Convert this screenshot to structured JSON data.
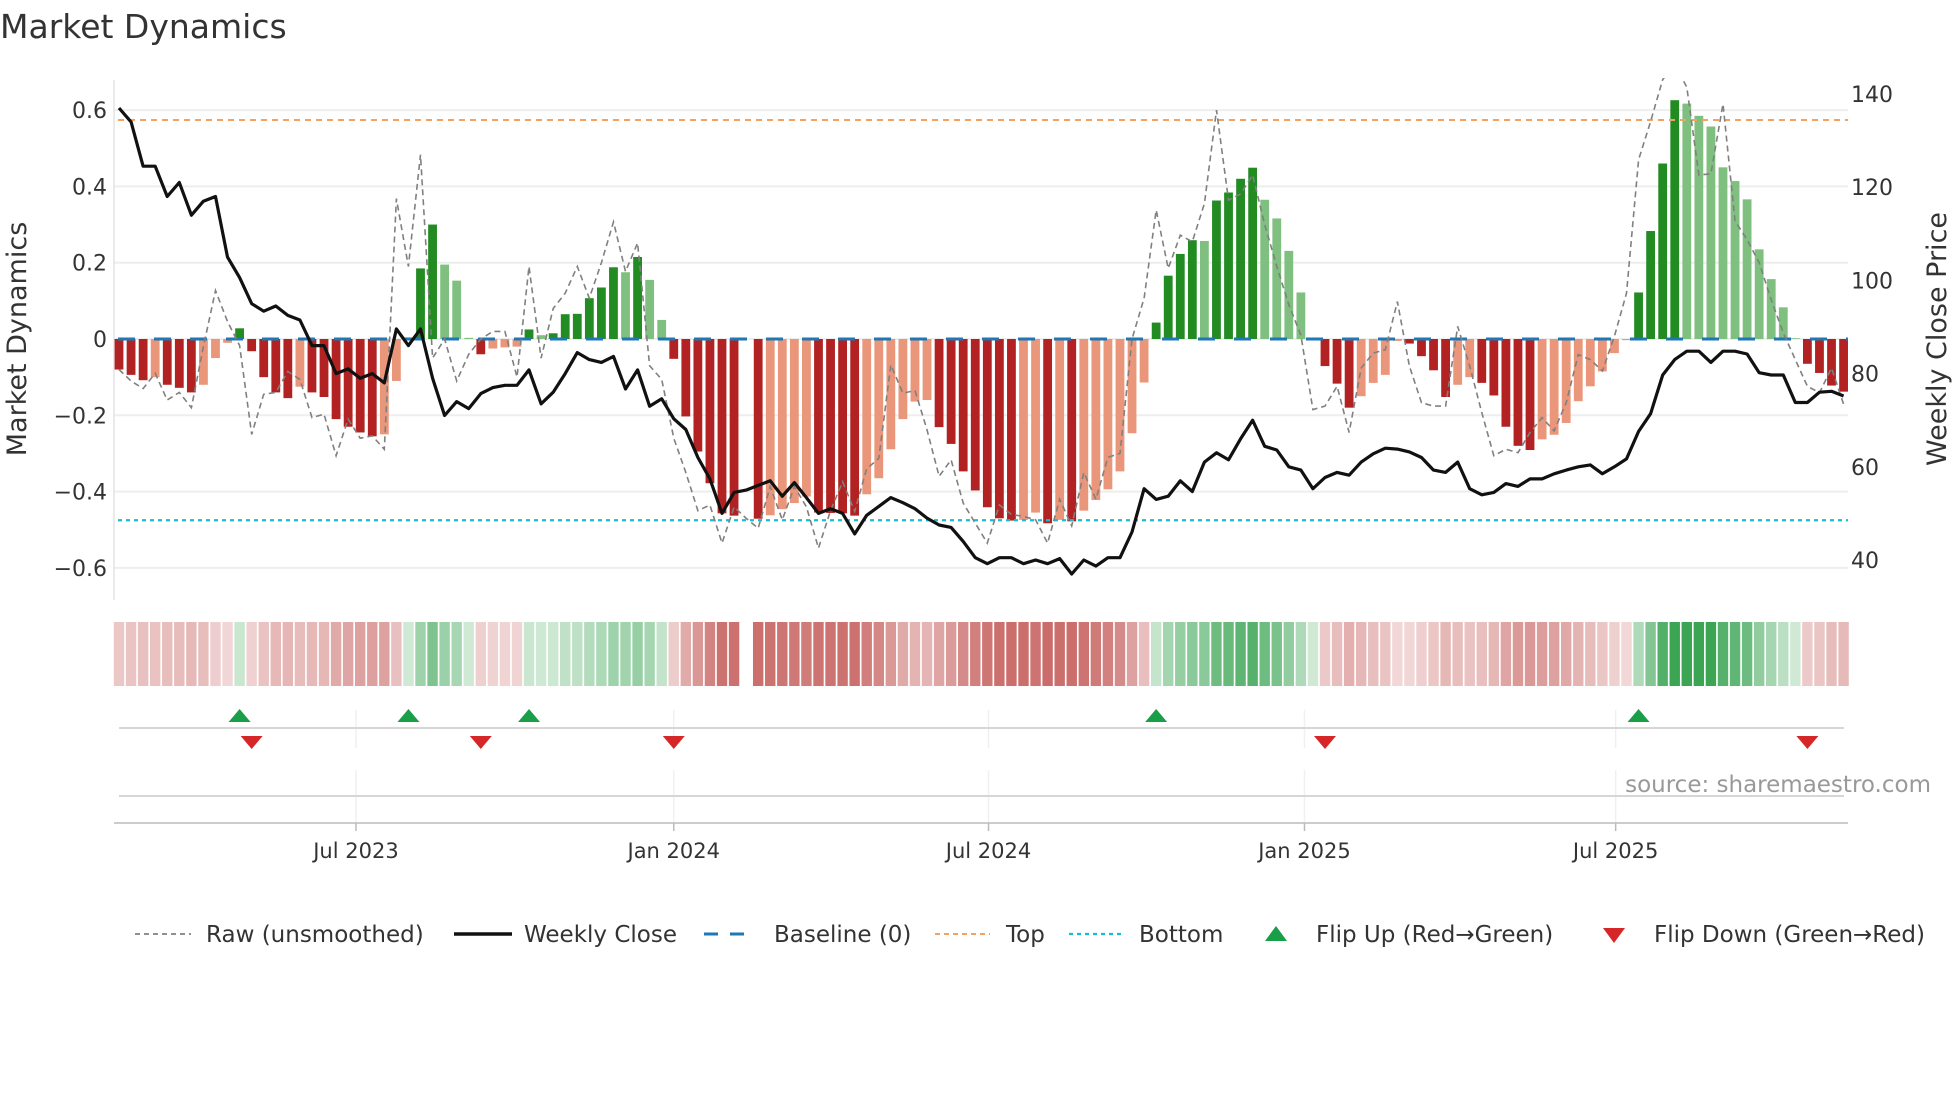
{
  "title": "Market Dynamics",
  "source": "source: sharemaestro.com",
  "colors": {
    "bar_red_dark": "#b22222",
    "bar_red_light": "#e9967a",
    "bar_green_dark": "#228b22",
    "bar_green_light": "#7fbf7f",
    "band_red": "#c0504d",
    "band_green": "#2a9d45",
    "raw": "#808080",
    "close": "#111111",
    "baseline": "#1f77b4",
    "top": "#f4a261",
    "bottom": "#17becf",
    "flip_up": "#1a9e48",
    "flip_down": "#d62728"
  },
  "legend": [
    {
      "key": "raw",
      "label": "Raw (unsmoothed)"
    },
    {
      "key": "close",
      "label": "Weekly Close"
    },
    {
      "key": "baseline",
      "label": "Baseline (0)"
    },
    {
      "key": "top",
      "label": "Top"
    },
    {
      "key": "bottom",
      "label": "Bottom"
    },
    {
      "key": "flip_up",
      "label": "Flip Up (Red→Green)"
    },
    {
      "key": "flip_down",
      "label": "Flip Down (Green→Red)"
    }
  ],
  "chart_data": {
    "type": "bar",
    "title": "Market Dynamics",
    "ylabel": "Market Dynamics",
    "ylabel_right": "Weekly Close Price",
    "ylim": [
      -0.68,
      0.68
    ],
    "ylim_right": [
      33,
      146
    ],
    "yticks": [
      0.6,
      0.4,
      0.2,
      0,
      -0.2,
      -0.4,
      -0.6
    ],
    "ytick_labels": [
      "0.6",
      "0.4",
      "0.2",
      "0",
      "−0.2",
      "−0.4",
      "−0.6"
    ],
    "yticks_right": [
      140,
      120,
      100,
      80,
      60,
      40
    ],
    "ytick_labels_right": [
      "140",
      "120",
      "100",
      "80",
      "60",
      "40"
    ],
    "xticks": [
      {
        "label": "Jul 2023",
        "week": 19.65
      },
      {
        "label": "Jan 2024",
        "week": 46.0
      },
      {
        "label": "Jul 2024",
        "week": 72.1
      },
      {
        "label": "Jan 2025",
        "week": 98.3
      },
      {
        "label": "Jul 2025",
        "week": 124.1
      }
    ],
    "top_level": 0.574,
    "bottom_level": -0.475,
    "baseline": 0,
    "grid": true,
    "legend_position": "bottom",
    "series": [
      {
        "name": "Market Dynamics (smoothed)",
        "type": "bar",
        "values": [
          -0.08,
          -0.094,
          -0.108,
          -0.1,
          -0.12,
          -0.128,
          -0.14,
          -0.12,
          -0.05,
          -0.01,
          0.028,
          -0.032,
          -0.1,
          -0.14,
          -0.155,
          -0.125,
          -0.14,
          -0.152,
          -0.21,
          -0.23,
          -0.245,
          -0.255,
          -0.25,
          -0.11,
          0.004,
          0.185,
          0.3,
          0.195,
          0.153,
          0.003,
          -0.04,
          -0.025,
          -0.022,
          -0.02,
          0.025,
          0.01,
          0.015,
          0.065,
          0.066,
          0.107,
          0.135,
          0.188,
          0.175,
          0.215,
          0.155,
          0.05,
          -0.052,
          -0.203,
          -0.295,
          -0.378,
          -0.457,
          -0.463,
          null,
          -0.471,
          -0.462,
          -0.446,
          -0.43,
          -0.413,
          -0.455,
          -0.456,
          -0.457,
          -0.463,
          -0.407,
          -0.365,
          -0.289,
          -0.21,
          -0.164,
          -0.16,
          -0.231,
          -0.275,
          -0.347,
          -0.397,
          -0.441,
          -0.47,
          -0.476,
          -0.474,
          -0.455,
          -0.483,
          -0.474,
          -0.478,
          -0.45,
          -0.422,
          -0.394,
          -0.347,
          -0.247,
          -0.114,
          0.043,
          0.166,
          0.223,
          0.259,
          0.257,
          0.363,
          0.384,
          0.42,
          0.449,
          0.365,
          0.316,
          0.231,
          0.122,
          0.003,
          -0.071,
          -0.117,
          -0.18,
          -0.15,
          -0.115,
          -0.094,
          -0.005,
          -0.012,
          -0.045,
          -0.082,
          -0.152,
          -0.12,
          -0.1,
          -0.115,
          -0.148,
          -0.23,
          -0.28,
          -0.291,
          -0.263,
          -0.251,
          -0.22,
          -0.163,
          -0.124,
          -0.085,
          -0.037,
          -0.003,
          0.122,
          0.283,
          0.46,
          0.626,
          0.617,
          0.585,
          0.557,
          0.45,
          0.414,
          0.366,
          0.235,
          0.157,
          0.083,
          0.002,
          -0.065,
          -0.089,
          -0.122,
          -0.138
        ]
      },
      {
        "name": "Raw (unsmoothed)",
        "type": "line",
        "values": [
          -0.08,
          -0.11,
          -0.13,
          -0.09,
          -0.16,
          -0.14,
          -0.18,
          -0.02,
          0.127,
          0.046,
          -0.017,
          -0.25,
          -0.145,
          -0.14,
          -0.085,
          -0.106,
          -0.206,
          -0.197,
          -0.306,
          -0.21,
          -0.26,
          -0.254,
          -0.289,
          0.368,
          0.19,
          0.483,
          -0.05,
          0.0,
          -0.11,
          -0.04,
          0.0,
          0.02,
          0.02,
          -0.1,
          0.19,
          -0.05,
          0.08,
          0.12,
          0.19,
          0.107,
          0.2,
          0.307,
          0.177,
          0.252,
          -0.07,
          -0.106,
          -0.26,
          -0.35,
          -0.45,
          -0.435,
          -0.535,
          -0.44,
          -0.47,
          -0.496,
          -0.387,
          -0.474,
          -0.387,
          -0.44,
          -0.548,
          -0.45,
          -0.374,
          -0.452,
          -0.34,
          -0.313,
          -0.068,
          -0.142,
          -0.135,
          -0.238,
          -0.36,
          -0.317,
          -0.43,
          -0.483,
          -0.535,
          -0.435,
          -0.46,
          -0.465,
          -0.474,
          -0.535,
          -0.42,
          -0.49,
          -0.35,
          -0.42,
          -0.31,
          -0.3,
          0.0,
          0.107,
          0.338,
          0.185,
          0.272,
          0.255,
          0.355,
          0.6,
          0.364,
          0.38,
          0.43,
          0.3,
          0.19,
          0.09,
          0.01,
          -0.185,
          -0.176,
          -0.124,
          -0.245,
          -0.076,
          -0.037,
          -0.028,
          0.098,
          -0.071,
          -0.167,
          -0.176,
          -0.176,
          0.033,
          -0.071,
          -0.193,
          -0.306,
          -0.289,
          -0.298,
          -0.245,
          -0.206,
          -0.241,
          -0.167,
          -0.041,
          -0.054,
          -0.084,
          0.007,
          0.12,
          0.47,
          0.57,
          0.68,
          0.72,
          0.66,
          0.43,
          0.433,
          0.616,
          0.31,
          0.26,
          0.2,
          0.103,
          0.016,
          -0.054,
          -0.124,
          -0.141,
          -0.076,
          -0.171
        ]
      },
      {
        "name": "Weekly Close",
        "type": "line",
        "axis": "right",
        "values": [
          137,
          134,
          124.5,
          124.5,
          118,
          121,
          114,
          117,
          118,
          105,
          100.6,
          95,
          93.4,
          94.5,
          92.5,
          91.5,
          86,
          86,
          80,
          81,
          79,
          80,
          78,
          89.6,
          86,
          89.6,
          79,
          71,
          74,
          72.5,
          75.7,
          77,
          77.5,
          77.5,
          80.8,
          73.5,
          76,
          80,
          84.5,
          83,
          82.4,
          83.7,
          76.7,
          80.8,
          73,
          74.6,
          70.3,
          68,
          62,
          57.4,
          50,
          54.5,
          55,
          56,
          57,
          53.7,
          56.6,
          53.4,
          50,
          51,
          50,
          45.6,
          49.6,
          51.5,
          53.4,
          52.3,
          51,
          49,
          47.5,
          47,
          44,
          40.5,
          39.2,
          40.5,
          40.5,
          39.2,
          40,
          39.2,
          40.3,
          37,
          40,
          38.7,
          40.5,
          40.5,
          46,
          55.3,
          53,
          53.7,
          57,
          54.7,
          61,
          63,
          61.5,
          66,
          70,
          64.4,
          63.6,
          60,
          59.3,
          55.3,
          57.7,
          58.8,
          58.2,
          61,
          62.8,
          64,
          63.8,
          63.2,
          62,
          59.3,
          58.8,
          61,
          55.3,
          54,
          54.5,
          56.4,
          55.8,
          57.4,
          57.4,
          58.5,
          59.3,
          60,
          60.4,
          58.5,
          60,
          61.7,
          67.6,
          71.4,
          79.7,
          83,
          84.8,
          84.8,
          82.4,
          84.8,
          84.8,
          84.2,
          80.2,
          79.7,
          79.7,
          73.8,
          73.8,
          76,
          76.2,
          75.2
        ]
      }
    ],
    "flip_up_weeks": [
      10,
      24,
      34,
      86,
      126
    ],
    "flip_down_weeks": [
      11,
      30,
      46,
      100,
      140
    ]
  }
}
